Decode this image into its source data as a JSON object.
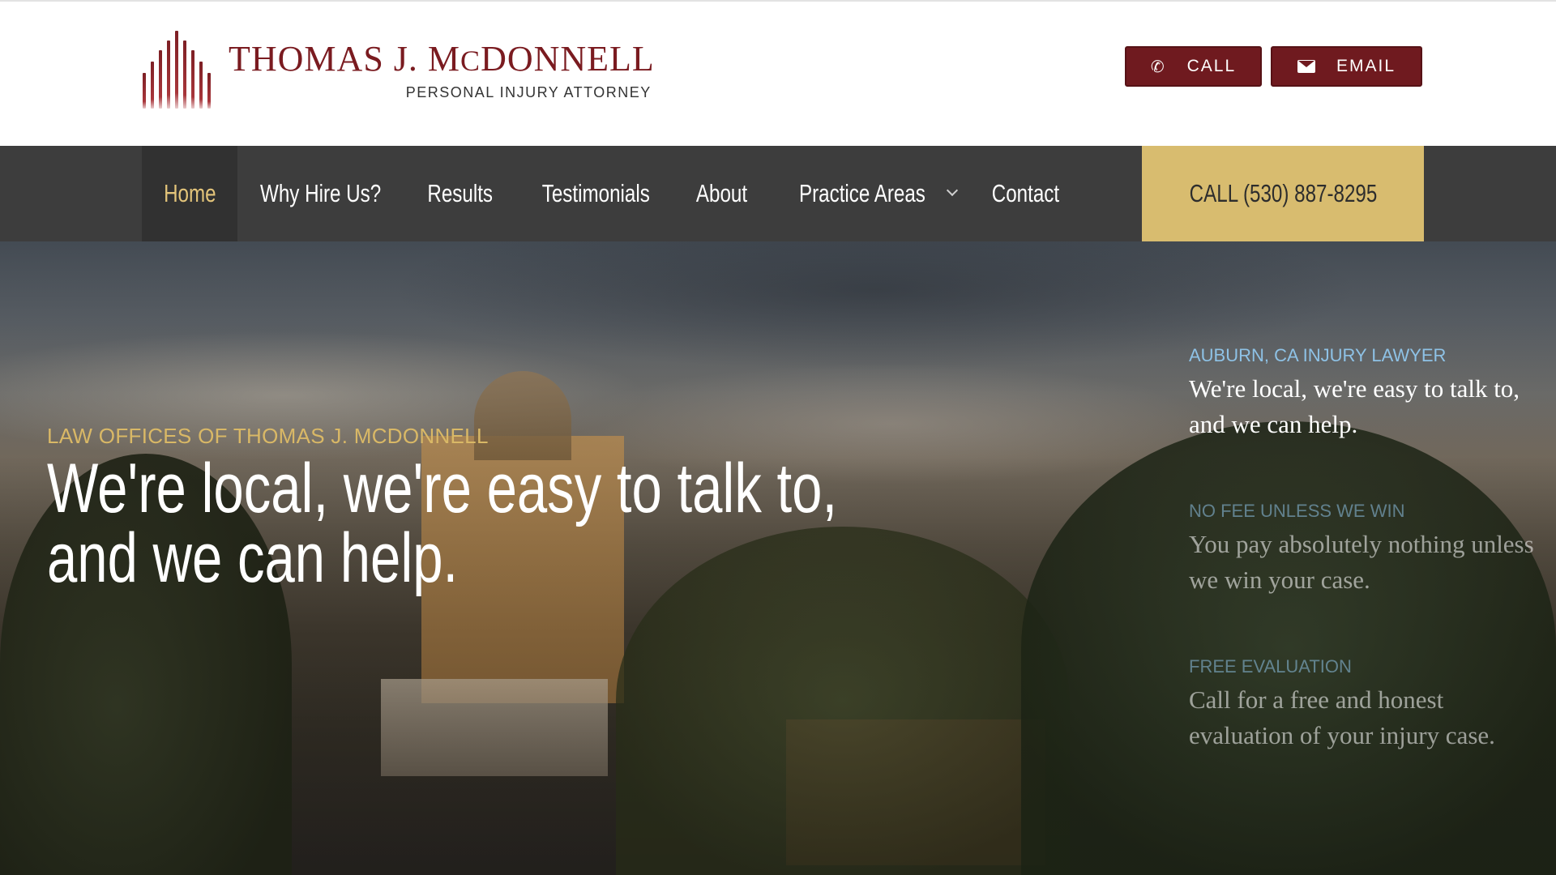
{
  "header": {
    "logo_name_first": "THOMAS J. M",
    "logo_name_small": "C",
    "logo_name_last": "DONNELL",
    "logo_subtitle": "PERSONAL INJURY ATTORNEY",
    "call_button_label": "CALL",
    "email_button_label": "EMAIL"
  },
  "nav": {
    "items": [
      {
        "label": "Home",
        "active": true
      },
      {
        "label": "Why Hire Us?"
      },
      {
        "label": "Results"
      },
      {
        "label": "Testimonials"
      },
      {
        "label": "About"
      },
      {
        "label": "Practice Areas"
      },
      {
        "label": "Contact"
      }
    ],
    "cta_label": "CALL (530) 887-8295"
  },
  "hero": {
    "eyebrow": "LAW OFFICES OF THOMAS J. MCDONNELL",
    "title_line1": "We're local, we're easy to talk to,",
    "title_line2": "and we can help."
  },
  "side_panels": [
    {
      "eyebrow": "AUBURN, CA INJURY LAWYER",
      "text": "We're local, we're easy to talk to, and we can help."
    },
    {
      "eyebrow": "NO FEE UNLESS WE WIN",
      "text": "You pay absolutely nothing unless we win your case."
    },
    {
      "eyebrow": "FREE EVALUATION",
      "text": "Call for a free and honest evaluation of your injury case."
    }
  ],
  "colors": {
    "brand_maroon": "#6f1a1f",
    "nav_bg": "#3d3d3d",
    "nav_active_text": "#e3c47a",
    "cta_gold": "#d8bc6f",
    "eyebrow_gold": "#d9b866",
    "eyebrow_blue": "#8ec2e6"
  },
  "icons": {
    "call": "phone-icon",
    "email": "envelope-icon",
    "dropdown": "chevron-down-icon"
  }
}
